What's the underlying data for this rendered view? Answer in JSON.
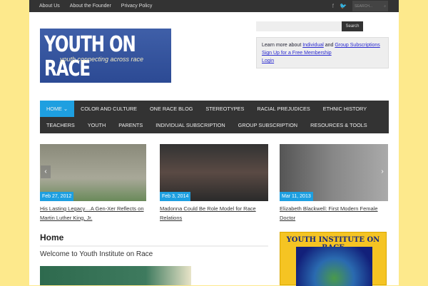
{
  "topbar": {
    "links": [
      "About Us",
      "About the Founder",
      "Privacy Policy"
    ],
    "search_placeholder": "SEARCH..."
  },
  "logo": {
    "title": "YOUTH ON RACE",
    "tagline": "youth connecting across race"
  },
  "search": {
    "button": "Search"
  },
  "info": {
    "prefix": "Learn more about ",
    "individual": "Individual",
    "and": " and ",
    "group": "Group Subscriptions",
    "signup": "Sign Up for a Free Membership",
    "login": "Login"
  },
  "nav": {
    "row1": [
      "HOME",
      "COLOR AND CULTURE",
      "ONE RACE BLOG",
      "STEREOTYPES",
      "RACIAL PREJUDICES",
      "ETHNIC HISTORY"
    ],
    "row2": [
      "TEACHERS",
      "YOUTH",
      "PARENTS",
      "INDIVIDUAL SUBSCRIPTION",
      "GROUP SUBSCRIPTION",
      "RESOURCES & TOOLS"
    ]
  },
  "slides": [
    {
      "date": "Feb 27, 2012",
      "title": "His Lasting Legacy…A Gen-Xer Reflects on Martin Luther King, Jr."
    },
    {
      "date": "Feb 3, 2014",
      "title": "Madonna Could Be Role Model for Race Relations"
    },
    {
      "date": "Mar 11, 2013",
      "title": "Elizabeth Blackwell: First Modern Female Doctor"
    }
  ],
  "main": {
    "heading": "Home",
    "welcome": "Welcome to Youth Institute on Race"
  },
  "sidebar": {
    "ad_title": "YOUTH INSTITUTE ON RACE"
  }
}
